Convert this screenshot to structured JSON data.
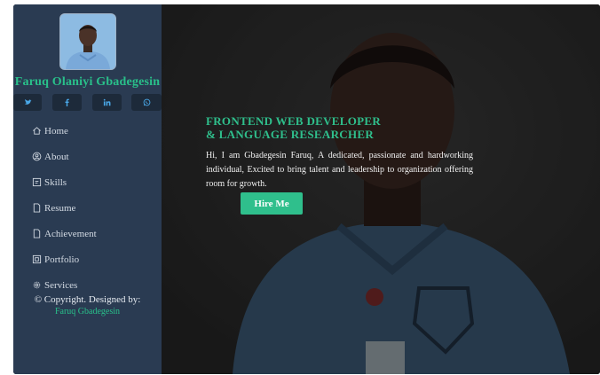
{
  "profile": {
    "name": "Faruq Olaniyi Gbadegesin"
  },
  "socials": [
    {
      "icon": "twitter-icon"
    },
    {
      "icon": "facebook-icon"
    },
    {
      "icon": "linkedin-icon"
    },
    {
      "icon": "whatsapp-icon"
    }
  ],
  "nav": [
    {
      "label": "Home",
      "icon": "home-icon"
    },
    {
      "label": "About",
      "icon": "user-circle-icon"
    },
    {
      "label": "Skills",
      "icon": "skills-icon"
    },
    {
      "label": "Resume",
      "icon": "document-icon"
    },
    {
      "label": "Achievement",
      "icon": "document-icon"
    },
    {
      "label": "Portfolio",
      "icon": "portfolio-icon"
    },
    {
      "label": "Services",
      "icon": "gear-icon"
    }
  ],
  "footer": {
    "copyright": "© Copyright. Designed by:",
    "author": "Faruq Gbadegesin"
  },
  "hero": {
    "headline_line1": "FRONTEND WEB DEVELOPER",
    "headline_line2": "& LANGUAGE RESEARCHER",
    "intro": "Hi, I am Gbadegesin Faruq, A dedicated, passionate and hardworking individual, Excited to bring talent and leadership to organization offering room for growth.",
    "cta_label": "Hire Me"
  },
  "colors": {
    "accent": "#2fbf8c",
    "sidebar": "#2a3b52",
    "social_button": "#1d2a3a"
  }
}
